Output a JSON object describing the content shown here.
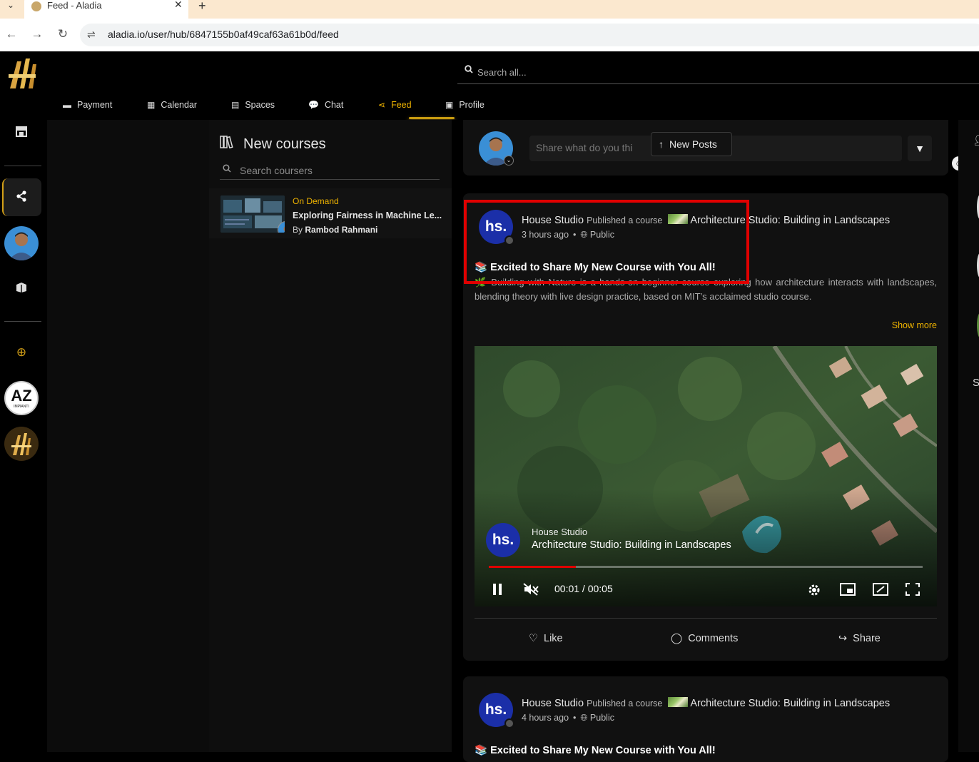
{
  "browser": {
    "tab_title": "Feed - Aladia",
    "url": "aladia.io/user/hub/6847155b0af49caf63a61b0d/feed",
    "tab_menu": "⌄",
    "tab_close": "✕",
    "new_tab": "+",
    "back": "←",
    "forward": "→",
    "reload": "↻",
    "site_info": "⇌"
  },
  "rail": {
    "create_icon": "⊕",
    "workspace_az_text": "AZ",
    "workspace_az_sub": "IMPIANTI"
  },
  "search": {
    "placeholder": "Search all..."
  },
  "nav": {
    "tabs": [
      {
        "label": "Payment",
        "icon": "▬"
      },
      {
        "label": "Calendar",
        "icon": "▦"
      },
      {
        "label": "Spaces",
        "icon": "▤"
      },
      {
        "label": "Chat",
        "icon": "💬"
      },
      {
        "label": "Feed",
        "icon": "⋖"
      },
      {
        "label": "Profile",
        "icon": "▣"
      }
    ],
    "active": "Feed",
    "accent_color": "#f0b400"
  },
  "courses": {
    "title": "New courses",
    "search_placeholder": "Search coursers",
    "items": [
      {
        "badge": "On Demand",
        "title": "Exploring Fairness in Machine Le...",
        "by_prefix": "By",
        "author": "Rambod Rahmani"
      }
    ]
  },
  "composer": {
    "placeholder": "Share what do you thi",
    "new_posts_label": "New Posts",
    "new_posts_icon": "↑",
    "emoji_icon": "☺",
    "filter_icon": "▼"
  },
  "posts": [
    {
      "avatar_text": "hs.",
      "author": "House Studio",
      "action": "Published a course",
      "course": "Architecture Studio: Building in Landscapes",
      "time": "3 hours ago",
      "visibility": "Public",
      "headline": "📚 Excited to Share My New Course with You All!",
      "body": "🌿 Building with Nature is a hands-on beginner course exploring how architecture interacts with landscapes, blending theory with live design practice, based on MIT’s acclaimed studio course.",
      "show_more": "Show more",
      "video": {
        "avatar_text": "hs.",
        "author": "House Studio",
        "title": "Architecture Studio: Building in Landscapes",
        "time": "00:01 / 00:05",
        "progress": 0.2
      },
      "actions": {
        "like": "Like",
        "comments": "Comments",
        "share": "Share"
      }
    },
    {
      "avatar_text": "hs.",
      "author": "House Studio",
      "action": "Published a course",
      "course": "Architecture Studio: Building in Landscapes",
      "time": "4 hours ago",
      "visibility": "Public",
      "headline": "📚 Excited to Share My New Course with You All!"
    }
  ],
  "right_edge": {
    "letter": "S"
  }
}
